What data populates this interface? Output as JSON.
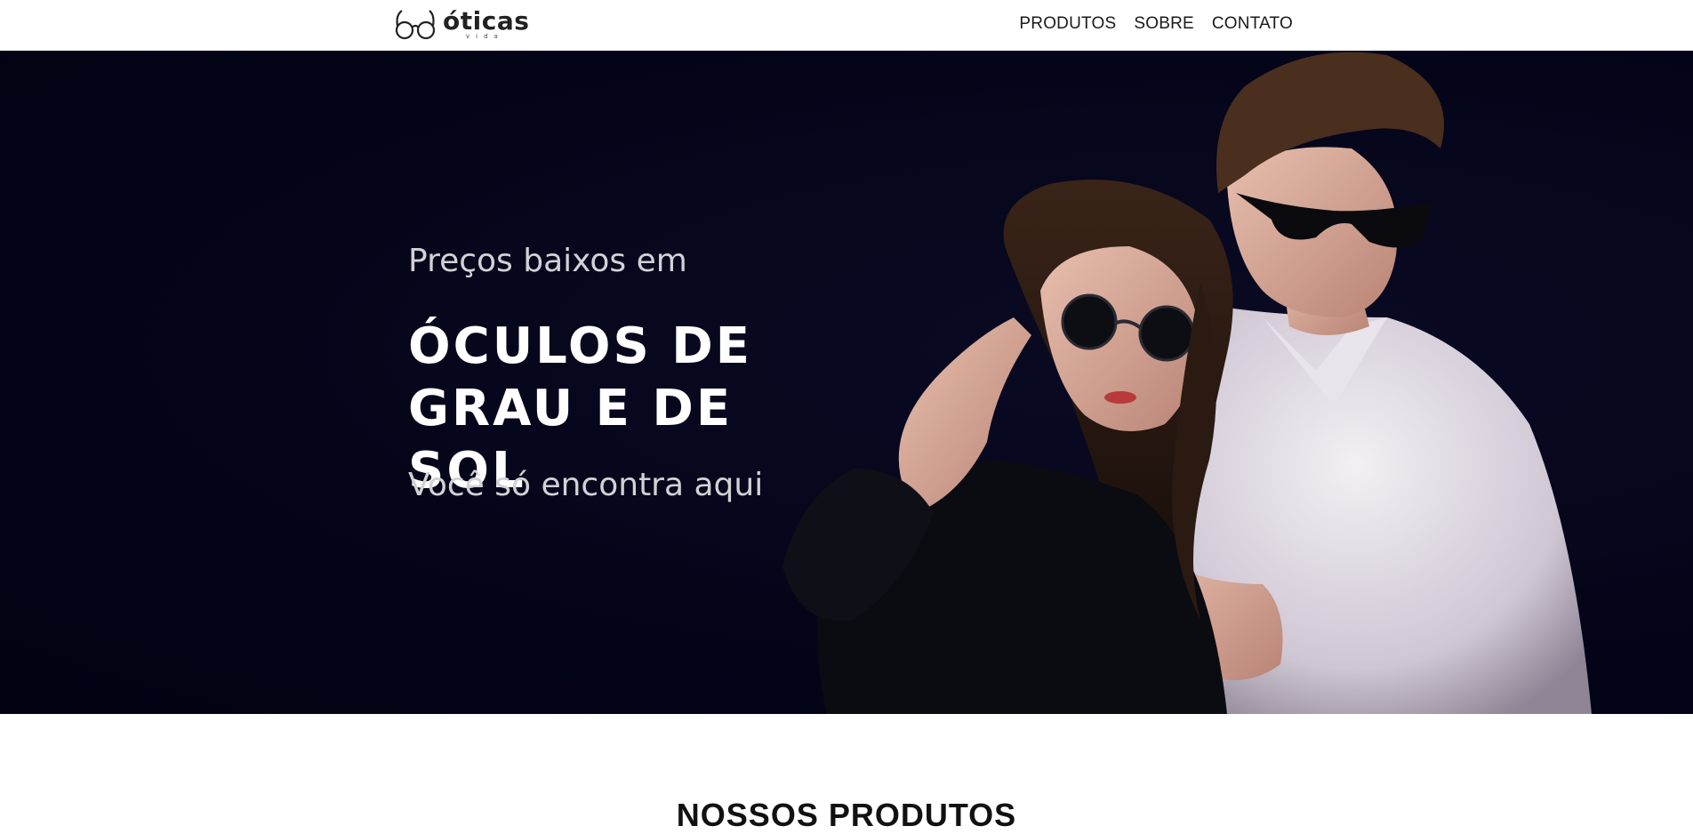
{
  "header": {
    "logo": {
      "name": "óticas",
      "tagline": "vida"
    },
    "nav": [
      {
        "label": "PRODUTOS"
      },
      {
        "label": "SOBRE"
      },
      {
        "label": "CONTATO"
      }
    ]
  },
  "hero": {
    "pretitle": "Preços baixos em",
    "title": "ÓCULOS DE GRAU E DE SOL",
    "subtitle": "Você só encontra aqui",
    "image": "couple-wearing-sunglasses-photo"
  },
  "products_section": {
    "title": "NOSSOS PRODUTOS"
  },
  "colors": {
    "hero_background": "#05051a",
    "text_dark": "#1a1a1a",
    "text_light": "#ffffff"
  }
}
